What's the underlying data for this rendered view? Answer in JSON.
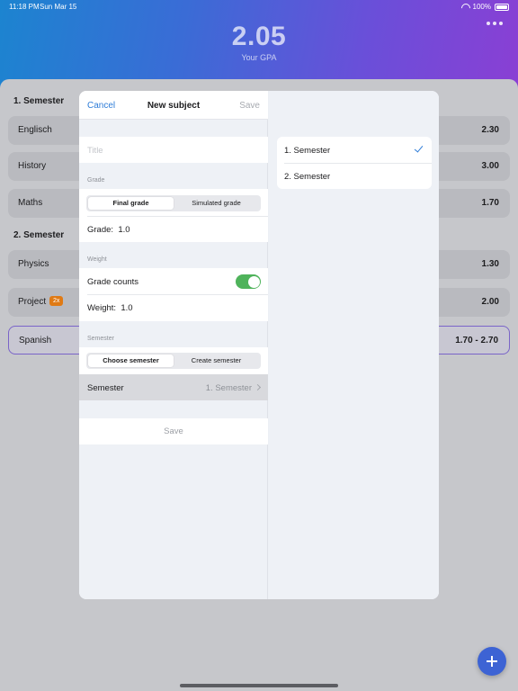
{
  "status": {
    "time": "11:18 PM",
    "date": "Sun Mar 15",
    "battery": "100%"
  },
  "header": {
    "gpa": "2.05",
    "gpa_label": "Your GPA"
  },
  "sections": [
    {
      "title": "1. Semester",
      "subjects": [
        {
          "name": "Englisch",
          "grade": "2.30"
        },
        {
          "name": "History",
          "grade": "3.00"
        },
        {
          "name": "Maths",
          "grade": "1.70"
        }
      ]
    },
    {
      "title": "2. Semester",
      "subjects": [
        {
          "name": "Physics",
          "grade": "1.30"
        },
        {
          "name": "Project",
          "badge": "2x",
          "grade": "2.00"
        },
        {
          "name": "Spanish",
          "grade": "1.70 - 2.70"
        }
      ]
    }
  ],
  "modal": {
    "cancel": "Cancel",
    "title": "New subject",
    "save": "Save",
    "title_placeholder": "Title",
    "grade_label": "Grade",
    "grade_segments": [
      "Final grade",
      "Simulated grade"
    ],
    "grade_value_label": "Grade:",
    "grade_value": "1.0",
    "weight_label": "Weight",
    "grade_counts": "Grade counts",
    "weight_value_label": "Weight:",
    "weight_value": "1.0",
    "semester_label": "Semester",
    "semester_segments": [
      "Choose semester",
      "Create semester"
    ],
    "semester_row_label": "Semester",
    "semester_row_value": "1. Semester",
    "save_button": "Save",
    "semester_options": [
      "1. Semester",
      "2. Semester"
    ]
  }
}
